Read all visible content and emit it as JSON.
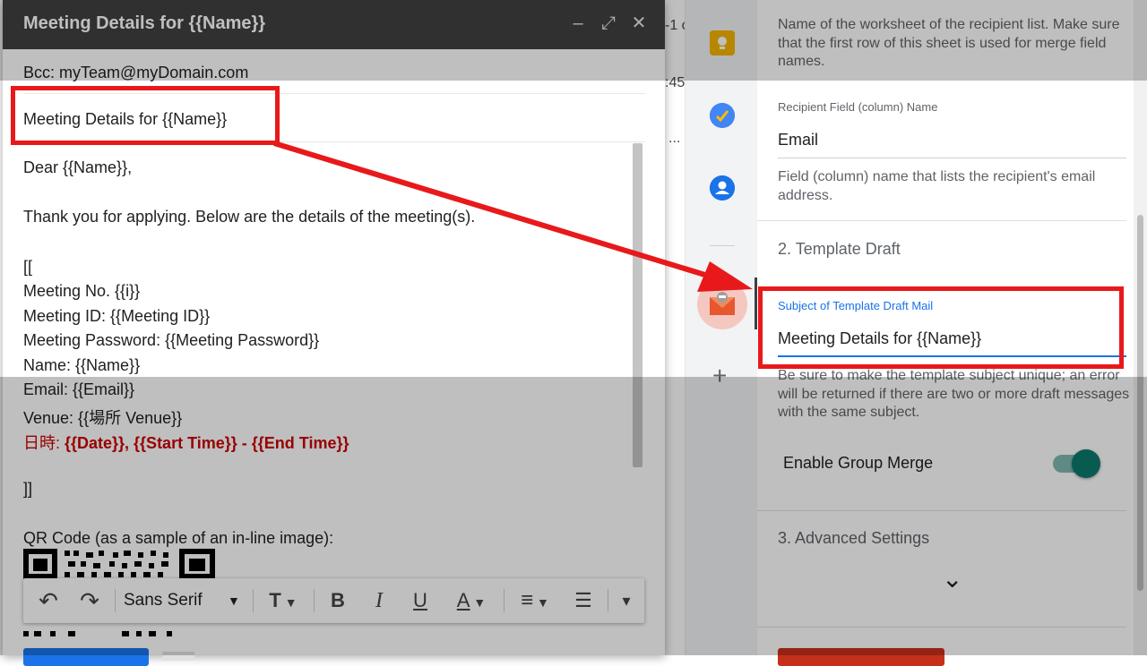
{
  "background": {
    "fragments": [
      "-1 c",
      ":45",
      "..."
    ]
  },
  "compose": {
    "title": "Meeting Details for {{Name}}",
    "controls": {
      "minimize": "–",
      "expand": "⤢",
      "close": "✕"
    },
    "bcc": "Bcc: myTeam@myDomain.com",
    "subject": "Meeting Details for {{Name}}",
    "body_lines": [
      "Dear {{Name}},",
      "Thank you for applying. Below are the details of the meeting(s).",
      "[[",
      "Meeting No. {{i}}",
      "Meeting ID: {{Meeting ID}}",
      "Meeting Password: {{Meeting Password}}",
      "Name: {{Name}}",
      "Email: {{Email}}",
      "Venue: {{場所 Venue}}"
    ],
    "red_line_prefix": "日時: ",
    "red_line_fields": "{{Date}}, {{Start Time}} - {{End Time}}",
    "close_bracket": "]]",
    "qr_label": "QR Code (as a sample of an in-line image):",
    "toolbar": {
      "undo": "↶",
      "redo": "↷",
      "font": "Sans Serif",
      "size": "T",
      "bold": "B",
      "italic": "I",
      "underline": "U",
      "text_color": "A",
      "align": "≡",
      "numbered": "☰",
      "more": "▾"
    }
  },
  "rail": {
    "add": "+"
  },
  "panel": {
    "worksheet_help": "Name of the worksheet of the recipient list. Make sure that the first row of this sheet is used for merge field names.",
    "recipient_field_label": "Recipient Field (column) Name",
    "recipient_field_value": "Email",
    "recipient_field_help": "Field (column) name that lists the recipient's email address.",
    "section2": "2. Template Draft",
    "subject_label": "Subject of Template Draft Mail",
    "subject_value": "Meeting Details for {{Name}}",
    "subject_help": "Be sure to make the template subject unique; an error will be returned if there are two or more draft messages with the same subject.",
    "group_merge_label": "Enable Group Merge",
    "group_merge_on": true,
    "section3": "3. Advanced Settings",
    "expand_icon": "⌄"
  },
  "colors": {
    "highlight": "#e8191b",
    "accent": "#1a73e8",
    "toggle": "#0b7a6b",
    "header": "#404040",
    "red_text": "#cc0000"
  }
}
